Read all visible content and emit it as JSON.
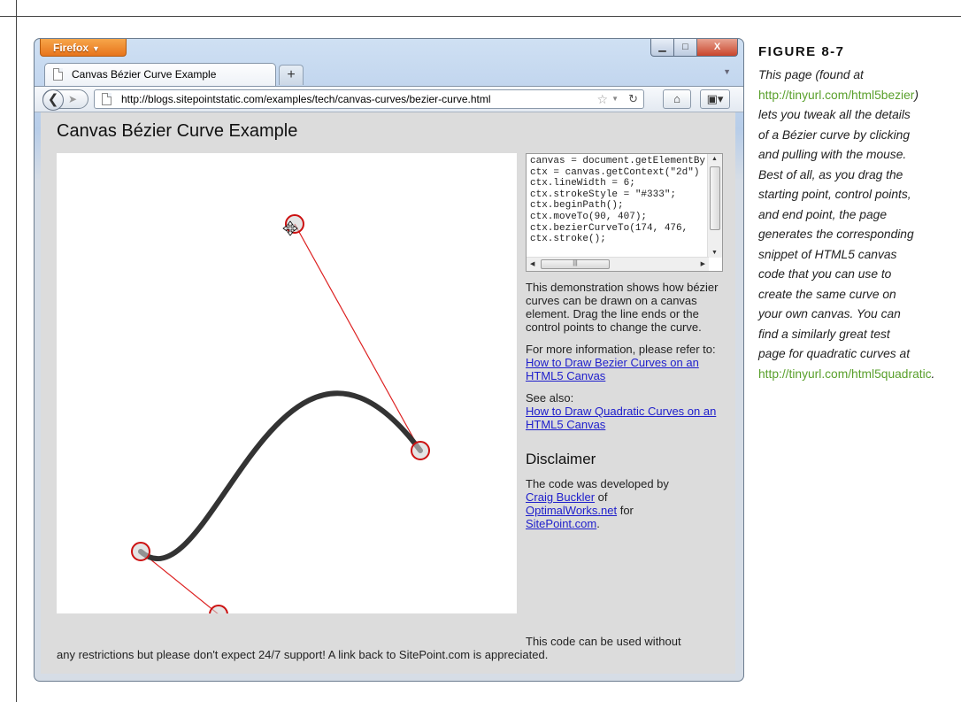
{
  "browser": {
    "menu_button": "Firefox",
    "tab_title": "Canvas Bézier Curve Example",
    "url": "http://blogs.sitepointstatic.com/examples/tech/canvas-curves/bezier-curve.html",
    "window_controls": {
      "minimize": "▭",
      "maximize": "□",
      "close": "X"
    }
  },
  "page": {
    "title": "Canvas Bézier Curve Example",
    "code_lines": [
      "canvas = document.getElementById(\"canvas\");",
      "ctx = canvas.getContext(\"2d\")",
      "ctx.lineWidth = 6;",
      "ctx.strokeStyle = \"#333\";",
      "ctx.beginPath();",
      "ctx.moveTo(90, 407);",
      "ctx.bezierCurveTo(174, 476, ",
      "ctx.stroke();"
    ],
    "description": "This demonstration shows how bézier curves can be drawn on a canvas element. Drag the line ends or the control points to change the curve.",
    "more_info_text": "For more information, please refer to:",
    "link_bezier": "How to Draw Bezier Curves on an HTML5 Canvas",
    "see_also_text": "See also:",
    "link_quadratic": "How to Draw Quadratic Curves on an HTML5 Canvas",
    "disclaimer_heading": "Disclaimer",
    "developed_prefix": "The code was developed by",
    "link_author": "Craig Buckler",
    "of_text": "of",
    "link_company": "OptimalWorks.net",
    "for_text": "for",
    "link_site": "SitePoint.com",
    "period": ".",
    "footer_line1": "This code can be used without",
    "footer_line2": "any restrictions but please don't expect 24/7 support! A link back to SitePoint.com is appreciated."
  },
  "caption": {
    "label": "FIGURE 8-7",
    "part1": "This page (found at ",
    "link1": "http://tinyurl.com/html5bezier",
    "part2": ") lets you tweak all the details of a Bézier curve by clicking and pulling with the mouse. Best of all, as you drag the starting point, control points, and end point, the page generates the corresponding snippet of HTML5 canvas code that you can use to create the same curve on your own canvas. You can find a similarly great test page for quadratic curves at ",
    "link2": "http://tinyurl.com/html5quadratic",
    "part3": "."
  },
  "colors": {
    "curve": "#333333",
    "control_line": "#dd2222",
    "handle_stroke": "#cc1111",
    "caption_link": "#5aa02c",
    "page_link": "#2020cc"
  },
  "icons": {
    "cursor": "move-cursor-icon"
  }
}
